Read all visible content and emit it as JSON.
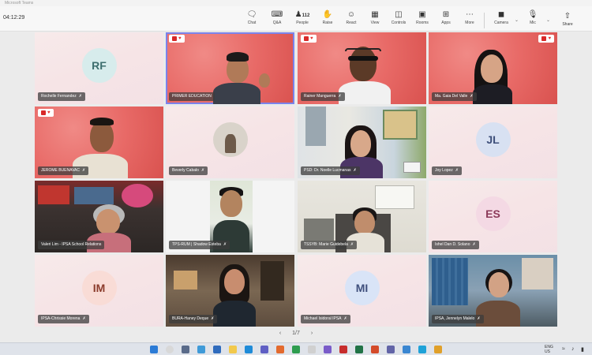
{
  "window": {
    "title": "Microsoft Teams",
    "time": "04:12:29"
  },
  "toolbar": {
    "chat": "Chat",
    "qa": "Q&A",
    "people": "People",
    "people_count": "112",
    "raise": "Raise",
    "react": "React",
    "view": "View",
    "controls": "Controls",
    "rooms": "Rooms",
    "apps": "Apps",
    "more": "More",
    "camera": "Camera",
    "mic": "Mic",
    "share": "Share"
  },
  "tiles": [
    {
      "name": "Rochelle Fernandez",
      "initials": "RF"
    },
    {
      "name": "PRIMER EDUCATION"
    },
    {
      "name": "Rainer Manguerra"
    },
    {
      "name": "Ma. Gaia Del Valle"
    },
    {
      "name": "JEROME BUENAVAC"
    },
    {
      "name": "Beverly Cabalo"
    },
    {
      "name": "PSD: Dr. Noelle Lucmanas"
    },
    {
      "name": "Joy Lopez",
      "initials": "JL"
    },
    {
      "name": "Valeri Lim - IPSA School Relations"
    },
    {
      "name": "TPS-RUM | Shadow Esteba"
    },
    {
      "name": "TSSYB: Marie Guidebela"
    },
    {
      "name": "Ishel Dan D. Solano",
      "initials": "ES"
    },
    {
      "name": "IPSA-Chrissie Morena",
      "initials": "IM"
    },
    {
      "name": "BURA-Haney Deque"
    },
    {
      "name": "Michael Isidoral IPSA",
      "initials": "MI"
    },
    {
      "name": "IPSA, Jennelyn Malelo"
    }
  ],
  "pager": {
    "prev": "‹",
    "label": "1/7",
    "next": "›"
  },
  "colors": {
    "accent": "#7b83eb",
    "brand_red": "#e86a67",
    "taskbar": "#dfe3ea"
  },
  "tray": {
    "lang": "ENG",
    "region": "US"
  }
}
